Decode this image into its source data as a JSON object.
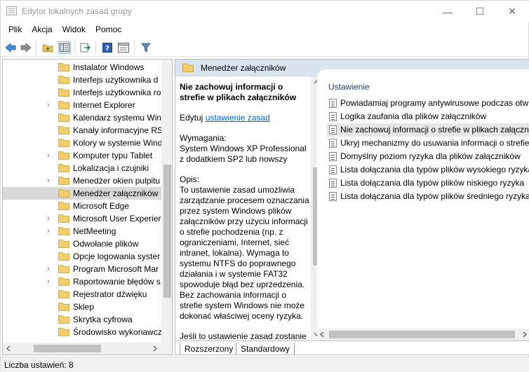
{
  "window": {
    "title": "Edytor lokalnych zasad grupy",
    "minimize": "—",
    "maximize": "☐",
    "close": "✕"
  },
  "menu": [
    "Plik",
    "Akcja",
    "Widok",
    "Pomoc"
  ],
  "toolbar": {
    "icons": [
      "back-icon",
      "forward-icon",
      "up-folder-icon",
      "show-hide-tree-icon",
      "export-list-icon",
      "help-icon",
      "extended-view-icon",
      "filter-icon"
    ]
  },
  "tree": {
    "items": [
      {
        "label": "Instalator Windows",
        "expandable": false
      },
      {
        "label": "Interfejs użytkownika d",
        "expandable": false
      },
      {
        "label": "Interfejs użytkownika ro",
        "expandable": false
      },
      {
        "label": "Internet Explorer",
        "expandable": true
      },
      {
        "label": "Kalendarz systemu Win",
        "expandable": false
      },
      {
        "label": "Kanały informacyjne RS",
        "expandable": false
      },
      {
        "label": "Kolory w systemie Wind",
        "expandable": false
      },
      {
        "label": "Komputer typu Tablet",
        "expandable": true
      },
      {
        "label": "Lokalizacja i czujniki",
        "expandable": false
      },
      {
        "label": "Menedżer okien pulpitu",
        "expandable": true
      },
      {
        "label": "Menedżer załączników",
        "expandable": false,
        "selected": true
      },
      {
        "label": "Microsoft Edge",
        "expandable": false
      },
      {
        "label": "Microsoft User Experien",
        "expandable": true
      },
      {
        "label": "NetMeeting",
        "expandable": true
      },
      {
        "label": "Odwołanie plików",
        "expandable": false
      },
      {
        "label": "Opcje logowania syster",
        "expandable": false
      },
      {
        "label": "Program Microsoft Mar",
        "expandable": true
      },
      {
        "label": "Raportowanie błędów s",
        "expandable": true
      },
      {
        "label": "Rejestrator dźwięku",
        "expandable": false
      },
      {
        "label": "Sklep",
        "expandable": false
      },
      {
        "label": "Skrytka cyfrowa",
        "expandable": false
      },
      {
        "label": "Środowisko wykonawcz",
        "expandable": false
      }
    ]
  },
  "panel": {
    "header": "Menedżer załączników",
    "description": {
      "title": "Nie zachowuj informacji o strefie w plikach załączników",
      "edit_prefix": "Edytuj",
      "edit_link": "ustawienie zasad",
      "requirements_label": "Wymagania:",
      "requirements": "System Windows XP Professional z dodatkiem SP2 lub nowszy",
      "description_label": "Opis:",
      "description": "To ustawienie zasad umożliwia zarządzanie procesem oznaczania przez system Windows plików załączników przy użyciu informacji o strefie pochodzenia (np. z ograniczeniami, Internet, sieć intranet, lokalna). Wymaga to systemu NTFS do poprawnego działania i w systemie FAT32 spowoduje błąd bez uprzedzenia. Bez zachowania informacji o strefie system Windows nie może dokonać właściwej oceny ryzyka.",
      "more": "Jeśli to ustawienie zasad zostanie"
    },
    "column_header": "Ustawienie",
    "settings": [
      {
        "label": "Powiadamiaj programy antywirusowe podczas otw"
      },
      {
        "label": "Logika zaufania dla plików załączników"
      },
      {
        "label": "Nie zachowuj informacji o strefie w plikach załączn",
        "selected": true
      },
      {
        "label": "Ukryj mechanizmy do usuwania informacji o strefie"
      },
      {
        "label": "Domyślny poziom ryzyka dla plików załączników"
      },
      {
        "label": "Lista dołączania dla typów plików wysokiego ryzyka"
      },
      {
        "label": "Lista dołączania dla typów plików niskiego ryzyka"
      },
      {
        "label": "Lista dołączania dla typów plików średniego ryzyka"
      }
    ],
    "tabs": [
      "Rozszerzony",
      "Standardowy"
    ],
    "active_tab": "Rozszerzony"
  },
  "status": "Liczba ustawień: 8",
  "colors": {
    "header_bg": "#d8e4ef",
    "link": "#0066cc",
    "selected_row": "#d9d9d9"
  }
}
